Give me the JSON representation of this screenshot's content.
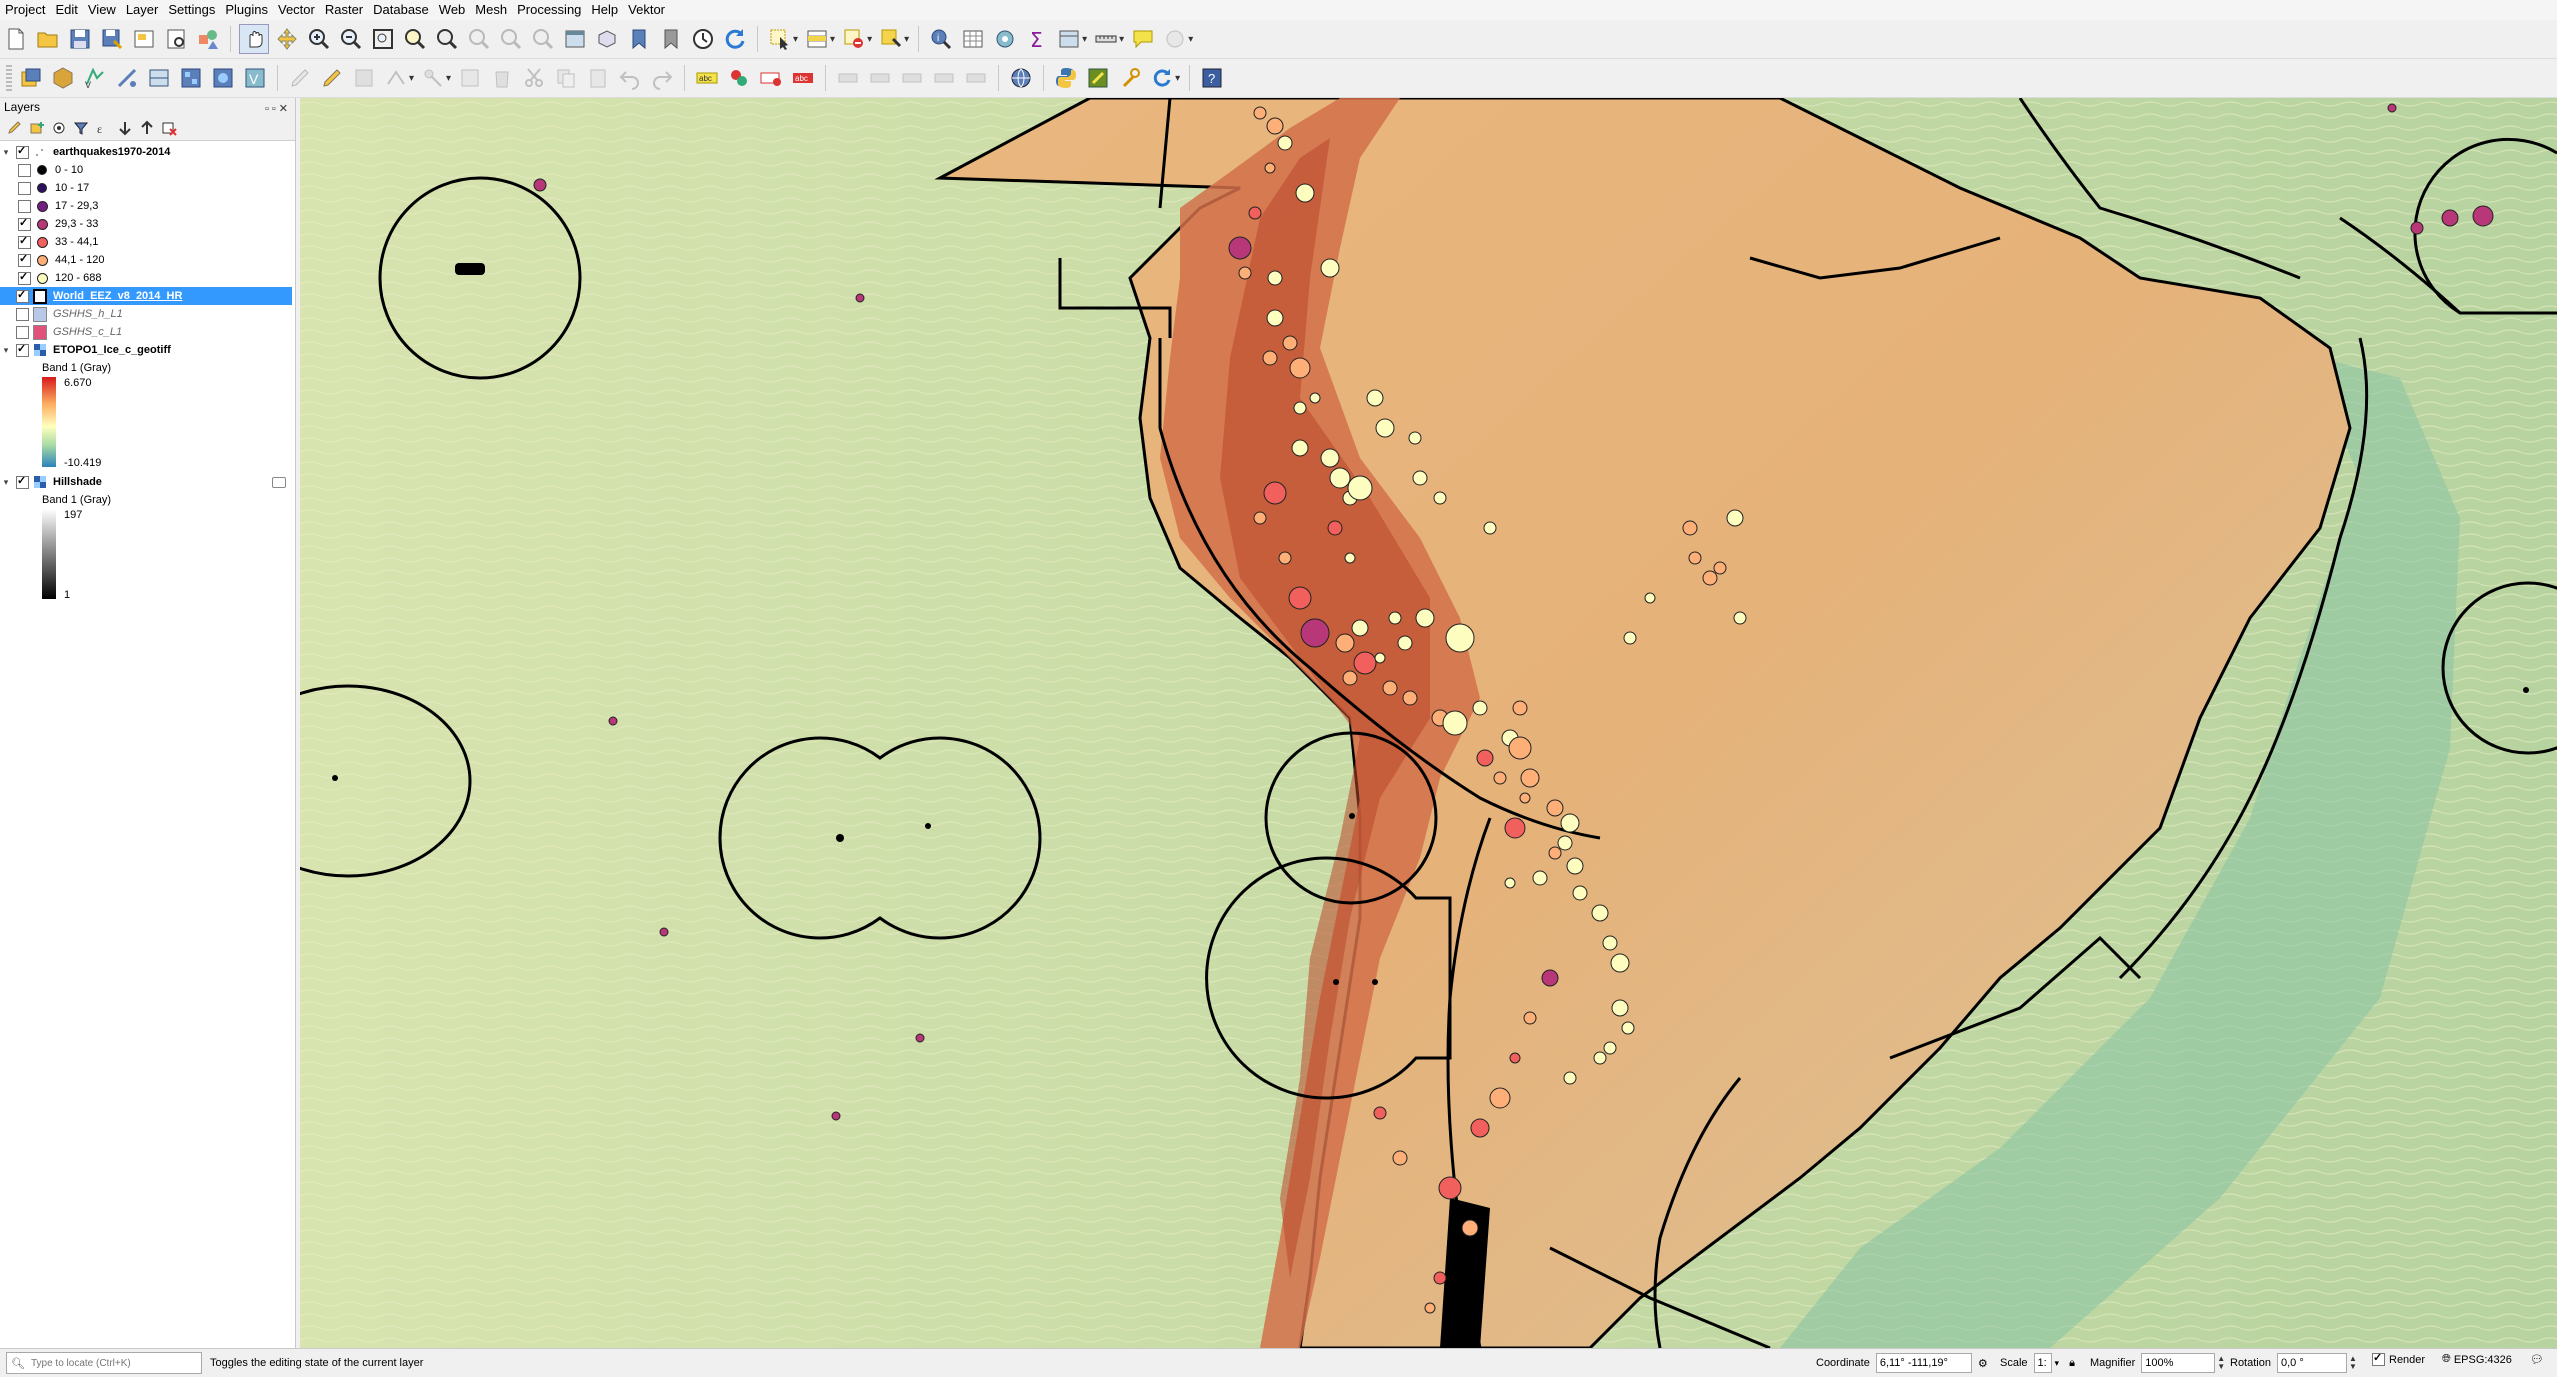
{
  "menubar": {
    "items": [
      "Project",
      "Edit",
      "View",
      "Layer",
      "Settings",
      "Plugins",
      "Vector",
      "Raster",
      "Database",
      "Web",
      "Mesh",
      "Processing",
      "Help",
      "Vektor"
    ]
  },
  "layers_panel": {
    "title": "Layers",
    "dock_buttons": "▫▫✕"
  },
  "layers": {
    "earthquakes": {
      "name": "earthquakes1970-2014",
      "classes": [
        {
          "label": "0 - 10",
          "checked": false,
          "color": "#000004",
          "size": 8
        },
        {
          "label": "10 - 17",
          "checked": false,
          "color": "#2c115f",
          "size": 8
        },
        {
          "label": "17 - 29,3",
          "checked": false,
          "color": "#721f81",
          "size": 9
        },
        {
          "label": "29,3 - 33",
          "checked": true,
          "color": "#b73779",
          "size": 9
        },
        {
          "label": "33 - 44,1",
          "checked": true,
          "color": "#f1605d",
          "size": 9
        },
        {
          "label": "44,1 - 120",
          "checked": true,
          "color": "#feaf77",
          "size": 9
        },
        {
          "label": "120 - 688",
          "checked": true,
          "color": "#fcfdbf",
          "size": 9
        }
      ]
    },
    "eez": {
      "name": "World_EEZ_v8_2014_HR"
    },
    "gshhs_h": {
      "name": "GSHHS_h_L1",
      "color": "#b7c9e6"
    },
    "gshhs_c": {
      "name": "GSHHS_c_L1",
      "color": "#e0527a"
    },
    "etopo": {
      "name": "ETOPO1_Ice_c_geotiff",
      "band": "Band 1 (Gray)",
      "max": "6.670",
      "min": "-10.419"
    },
    "hillshade": {
      "name": "Hillshade",
      "band": "Band 1 (Gray)",
      "max": "197",
      "min": "1"
    }
  },
  "statusbar": {
    "locator_placeholder": "Type to locate (Ctrl+K)",
    "message": "Toggles the editing state of the current layer",
    "coordinate_label": "Coordinate",
    "coordinate_value": "6,11° -111,19°",
    "scale_label": "Scale",
    "scale_value": "1:",
    "magnifier_label": "Magnifier",
    "magnifier_value": "100%",
    "rotation_label": "Rotation",
    "rotation_value": "0,0 °",
    "render_label": "Render",
    "crs": "EPSG:4326"
  },
  "icons": {
    "toolbar1": [
      "new-project-icon",
      "open-project-icon",
      "save-project-icon",
      "save-as-icon",
      "print-layout-icon",
      "layout-manager-icon",
      "style-manager-icon",
      "pan-icon",
      "pan-to-selection-icon",
      "zoom-in-icon",
      "zoom-out-icon",
      "zoom-full-icon",
      "zoom-selection-icon",
      "zoom-layer-icon",
      "zoom-native-icon",
      "zoom-last-icon",
      "zoom-next-icon",
      "new-map-view-icon",
      "new-3d-view-icon",
      "bookmark-new-icon",
      "bookmarks-icon",
      "temporal-controller-icon",
      "refresh-icon",
      "select-features-icon",
      "select-value-icon",
      "deselect-icon",
      "identify-icon",
      "attribute-table-icon",
      "field-calculator-icon",
      "statistics-icon",
      "toolbox-icon",
      "measure-icon",
      "map-tips-icon",
      "annotation-icon"
    ],
    "toolbar2": [
      "data-source-manager-icon",
      "new-geopackage-icon",
      "new-shapefile-icon",
      "new-spatialite-icon",
      "new-virtual-layer-icon",
      "add-raster-icon",
      "add-wms-icon",
      "add-vector-icon",
      "digitize-icon",
      "toggle-editing-icon",
      "save-edits-icon",
      "add-feature-icon",
      "vertex-tool-icon",
      "delete-selected-icon",
      "cut-features-icon",
      "copy-features-icon",
      "paste-features-icon",
      "undo-icon",
      "redo-icon",
      "label-icon",
      "pin-labels-icon",
      "show-labels-icon",
      "python-console-icon",
      "plugin-icon",
      "help-icon"
    ]
  }
}
